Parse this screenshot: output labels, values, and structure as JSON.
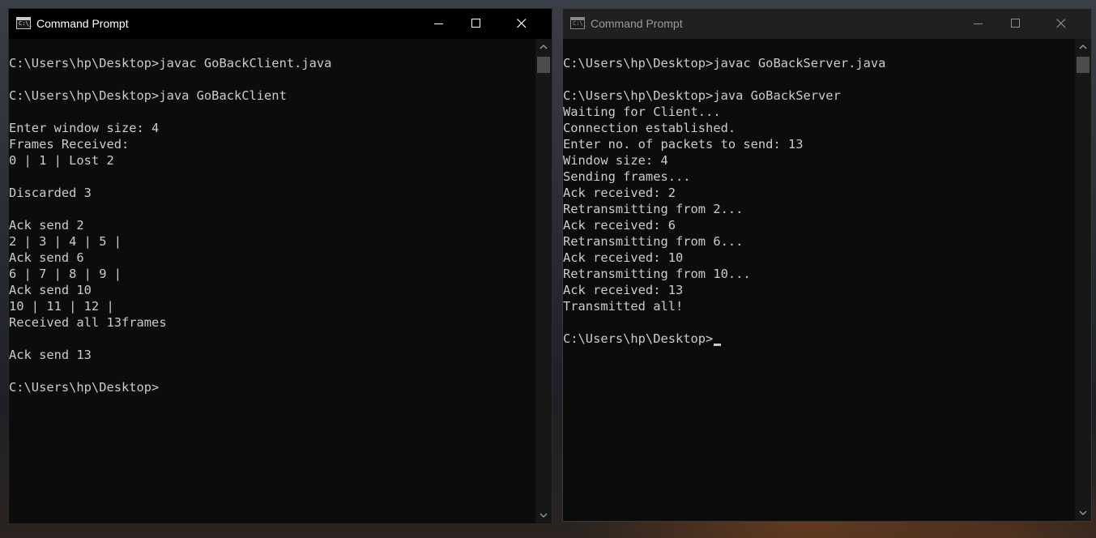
{
  "client_window": {
    "title": "Command Prompt",
    "active": true,
    "lines": [
      "",
      "C:\\Users\\hp\\Desktop>javac GoBackClient.java",
      "",
      "C:\\Users\\hp\\Desktop>java GoBackClient",
      "",
      "Enter window size: 4",
      "Frames Received:",
      "0 | 1 | Lost 2",
      "",
      "Discarded 3",
      "",
      "Ack send 2",
      "2 | 3 | 4 | 5 |",
      "Ack send 6",
      "6 | 7 | 8 | 9 |",
      "Ack send 10",
      "10 | 11 | 12 |",
      "Received all 13frames",
      "",
      "Ack send 13",
      "",
      "C:\\Users\\hp\\Desktop>"
    ]
  },
  "server_window": {
    "title": "Command Prompt",
    "active": false,
    "lines": [
      "",
      "C:\\Users\\hp\\Desktop>javac GoBackServer.java",
      "",
      "C:\\Users\\hp\\Desktop>java GoBackServer",
      "Waiting for Client...",
      "Connection established.",
      "Enter no. of packets to send: 13",
      "Window size: 4",
      "Sending frames...",
      "Ack received: 2",
      "Retransmitting from 2...",
      "Ack received: 6",
      "Retransmitting from 6...",
      "Ack received: 10",
      "Retransmitting from 10...",
      "Ack received: 13",
      "Transmitted all!",
      "",
      "C:\\Users\\hp\\Desktop>"
    ]
  },
  "icons": {
    "app": "command-prompt-icon",
    "minimize": "minimize-icon",
    "maximize": "maximize-icon",
    "close": "close-icon",
    "scroll_up": "chevron-up-icon",
    "scroll_down": "chevron-down-icon"
  },
  "colors": {
    "console_background": "#0c0c0c",
    "console_text": "#cccccc",
    "active_titlebar": "#000000",
    "inactive_titlebar": "#202020",
    "active_title_text": "#ffffff",
    "inactive_title_text": "#9b9b9b"
  }
}
